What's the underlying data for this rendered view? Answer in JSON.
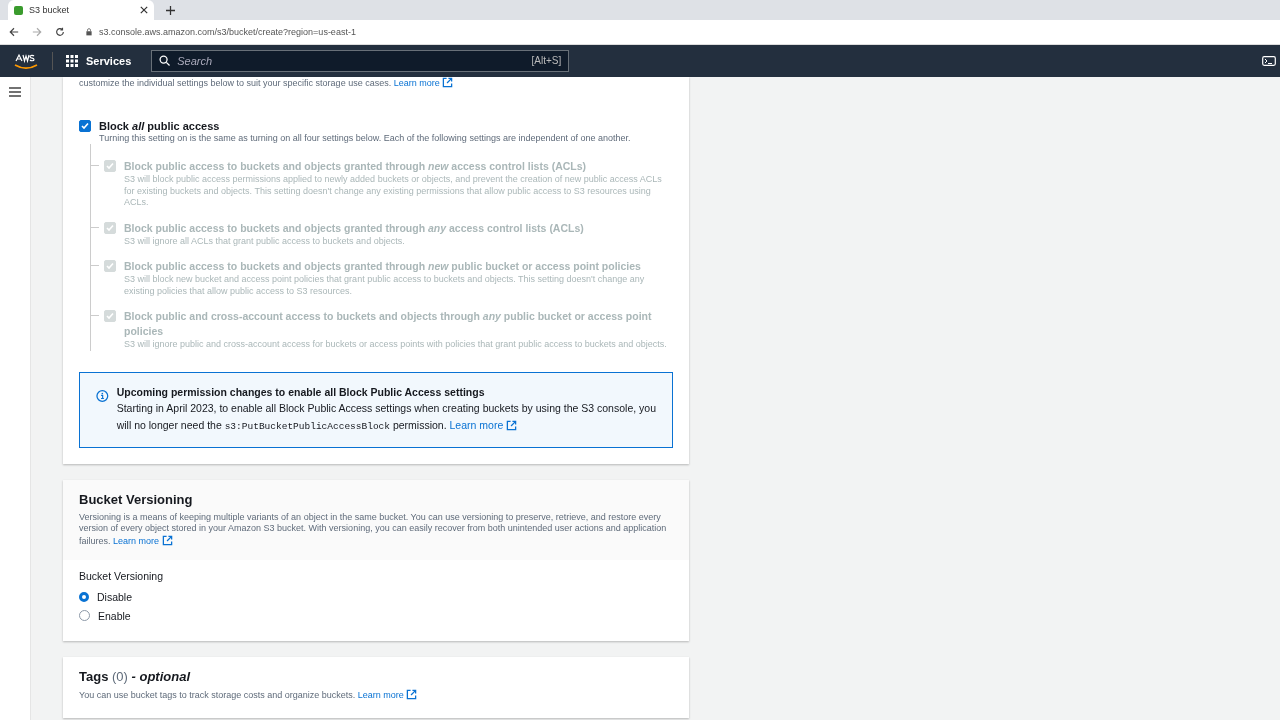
{
  "browser": {
    "tab_title": "S3 bucket",
    "url": "s3.console.aws.amazon.com/s3/bucket/create?region=us-east-1"
  },
  "nav": {
    "services_label": "Services",
    "search_placeholder": "Search",
    "search_shortcut": "[Alt+S]"
  },
  "block_public_access": {
    "intro_text": "customize the individual settings below to suit your specific storage use cases.",
    "intro_link": "Learn more",
    "master": {
      "label": "Block *all* public access",
      "description": "Turning this setting on is the same as turning on all four settings below. Each of the following settings are independent of one another.",
      "checked": true
    },
    "options": [
      {
        "label": "Block public access to buckets and objects granted through *new* access control lists (ACLs)",
        "description": "S3 will block public access permissions applied to newly added buckets or objects, and prevent the creation of new public access ACLs for existing buckets and objects. This setting doesn't change any existing permissions that allow public access to S3 resources using ACLs.",
        "checked": true,
        "disabled": true
      },
      {
        "label": "Block public access to buckets and objects granted through *any* access control lists (ACLs)",
        "description": "S3 will ignore all ACLs that grant public access to buckets and objects.",
        "checked": true,
        "disabled": true
      },
      {
        "label": "Block public access to buckets and objects granted through *new* public bucket or access point policies",
        "description": "S3 will block new bucket and access point policies that grant public access to buckets and objects. This setting doesn't change any existing policies that allow public access to S3 resources.",
        "checked": true,
        "disabled": true
      },
      {
        "label": "Block public and cross-account access to buckets and objects through *any* public bucket or access point policies",
        "description": "S3 will ignore public and cross-account access for buckets or access points with policies that grant public access to buckets and objects.",
        "checked": true,
        "disabled": true
      }
    ]
  },
  "info_alert": {
    "title": "Upcoming permission changes to enable all Block Public Access settings",
    "text_before": "Starting in April 2023, to enable all Block Public Access settings when creating buckets by using the S3 console, you will no longer need the",
    "code": "s3:PutBucketPublicAccessBlock",
    "text_after": "permission.",
    "link": "Learn more"
  },
  "versioning": {
    "title": "Bucket Versioning",
    "description": "Versioning is a means of keeping multiple variants of an object in the same bucket. You can use versioning to preserve, retrieve, and restore every version of every object stored in your Amazon S3 bucket. With versioning, you can easily recover from both unintended user actions and application failures.",
    "link": "Learn more",
    "field_label": "Bucket Versioning",
    "options": [
      {
        "label": "Disable",
        "selected": true
      },
      {
        "label": "Enable",
        "selected": false
      }
    ]
  },
  "tags": {
    "title": "Tags",
    "count": "(0)",
    "suffix": "- optional",
    "description": "You can use bucket tags to track storage costs and organize buckets.",
    "link": "Learn more"
  }
}
